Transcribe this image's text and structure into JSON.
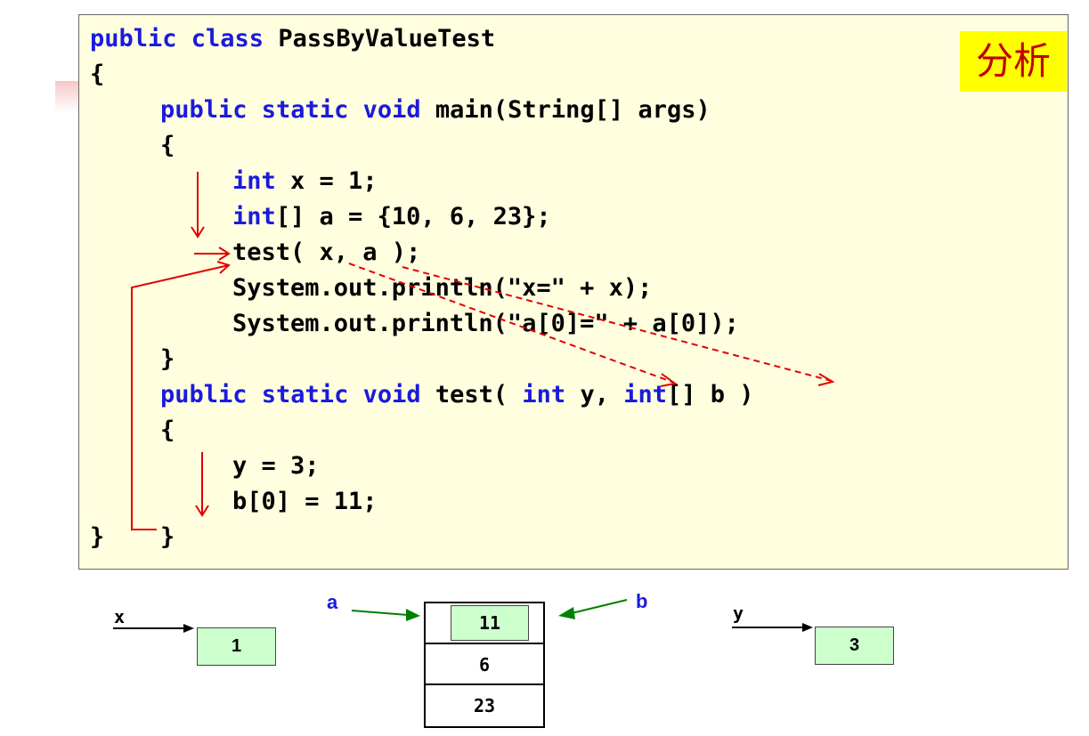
{
  "code": {
    "line1_kw": "public class",
    "line1_rest": " PassByValueTest",
    "line2": "{",
    "line3_kw": "public static void",
    "line3_rest": " main(String[] args)",
    "line4": "{",
    "line5_kw": "int",
    "line5_rest": " x = 1;",
    "line6_kw": "int",
    "line6_rest": "[] a = {10, 6, 23};",
    "line7": "test( x, a );",
    "line8": "System.out.println(\"x=\" + x);",
    "line9": "System.out.println(\"a[0]=\" + a[0]);",
    "line10": "}",
    "line11_kw1": "public static void",
    "line11_mid1": " test( ",
    "line11_kw2": "int",
    "line11_mid2": " y, ",
    "line11_kw3": "int",
    "line11_rest": "[] b )",
    "line12": "{",
    "line13": "y = 3;",
    "line14": "b[0] = 11;",
    "line15a": "}",
    "line15b": "}"
  },
  "badge": "分析",
  "memory": {
    "x_label": "x",
    "x_value": "1",
    "a_label": "a",
    "b_label": "b",
    "array_values": [
      "11",
      "6",
      "23"
    ],
    "y_label": "y",
    "y_value": "3"
  },
  "colors": {
    "code_background": "#ffffe0",
    "keyword": "#1a1adc",
    "flow_arrow": "#e00000",
    "pointer_arrow": "#008000",
    "cell_fill": "#ccffcc",
    "badge_background": "#ffff00",
    "badge_text": "#c00000"
  }
}
